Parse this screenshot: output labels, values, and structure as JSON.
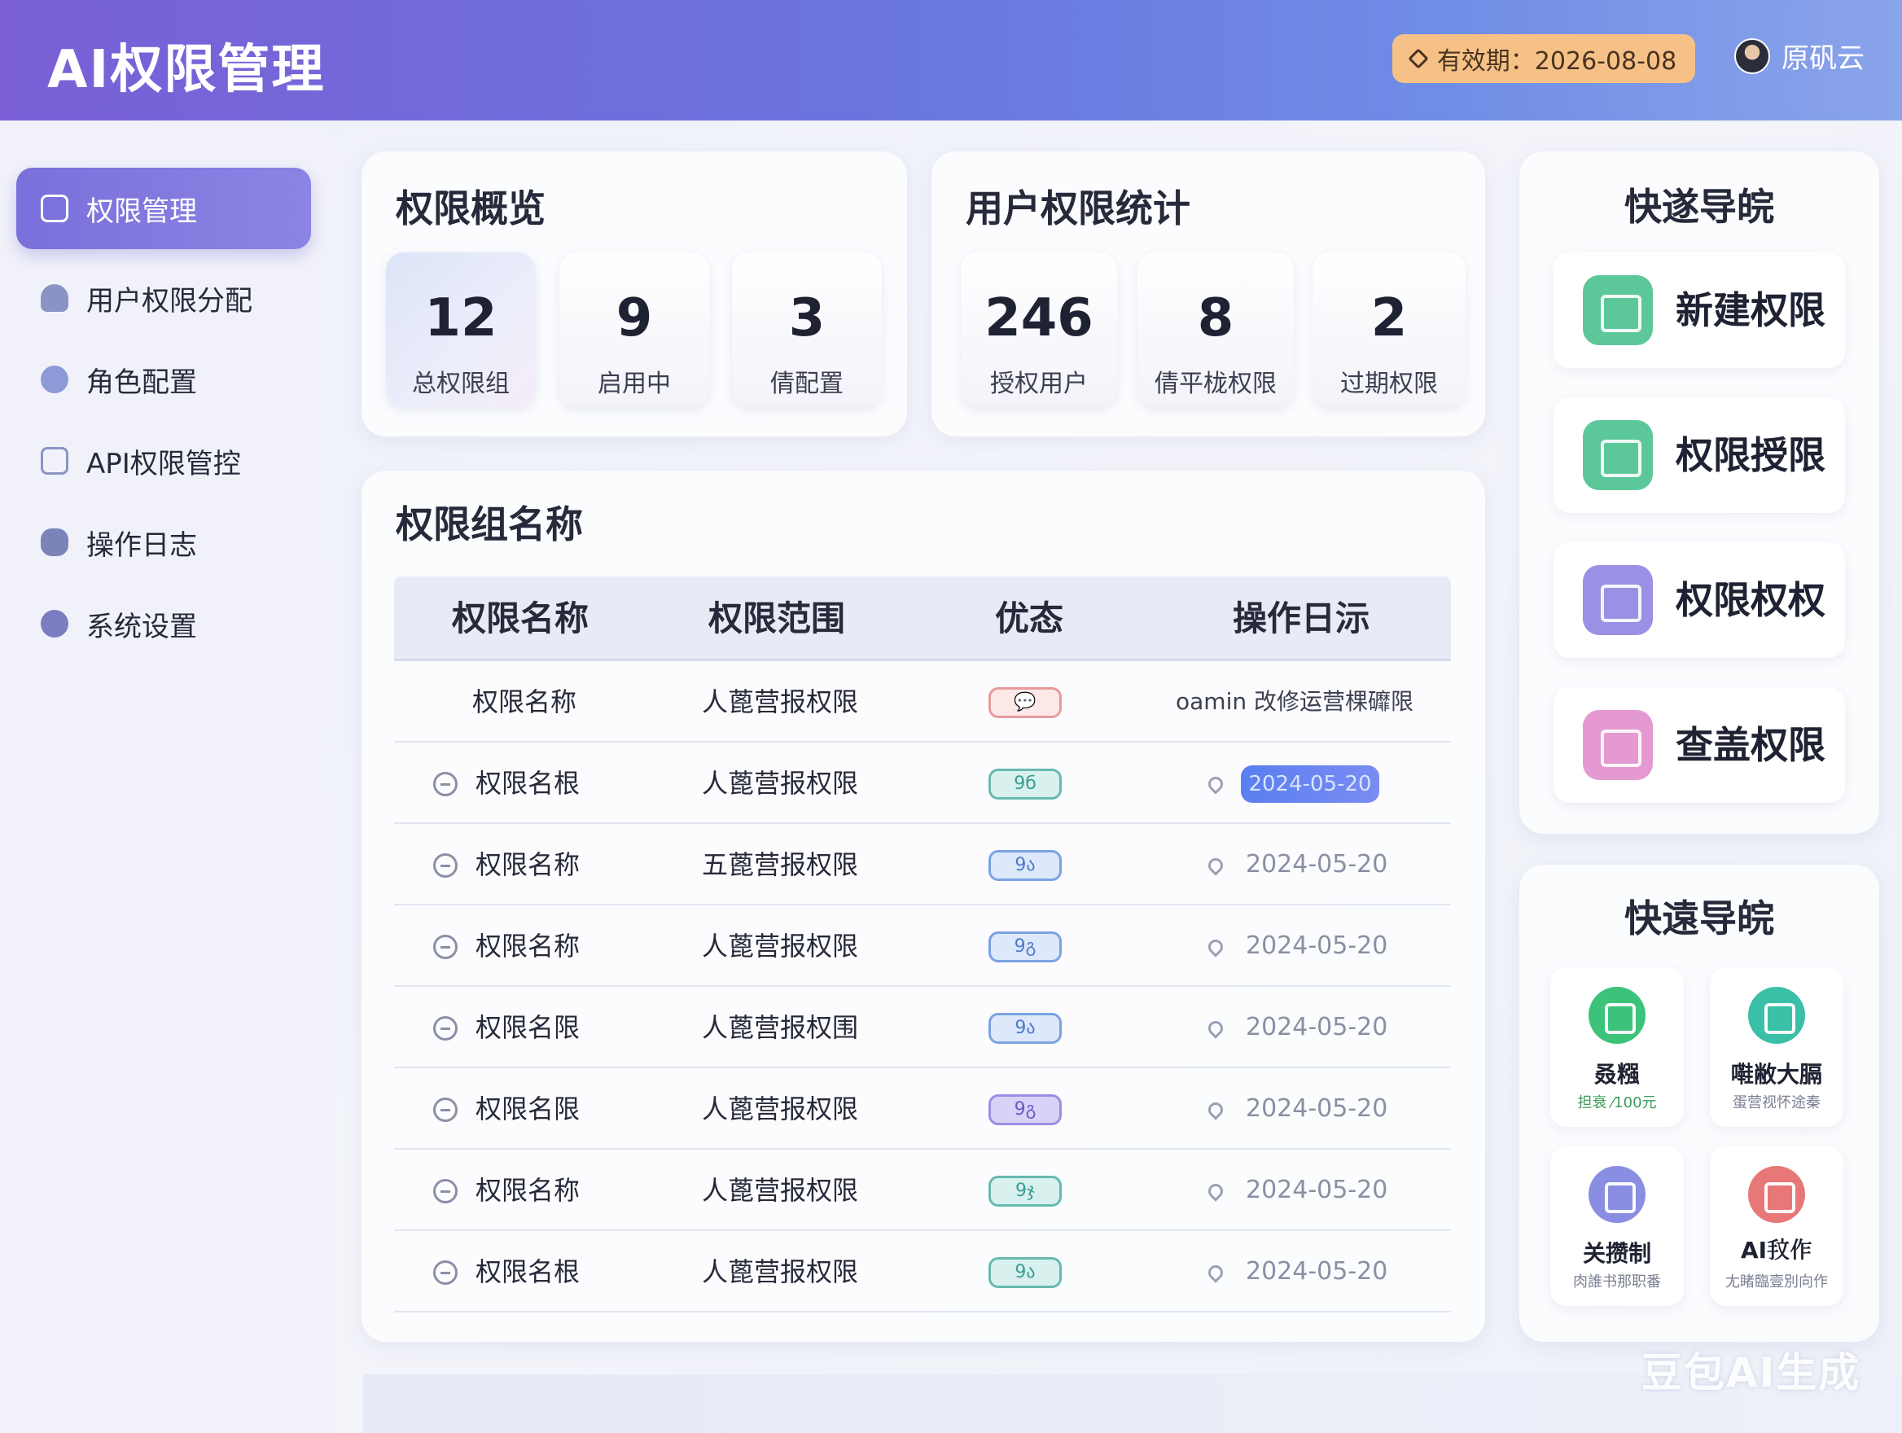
{
  "header": {
    "title": "AI权限管理",
    "validity": "有效期：2026-08-08",
    "user_name": "原矾云"
  },
  "sidebar": {
    "items": [
      {
        "label": "权限管理",
        "icon": "briefcase-icon",
        "active": true
      },
      {
        "label": "用户权限分配",
        "icon": "user-icon",
        "active": false
      },
      {
        "label": "角色配置",
        "icon": "role-icon",
        "active": false
      },
      {
        "label": "API权限管控",
        "icon": "api-icon",
        "active": false
      },
      {
        "label": "操作日志",
        "icon": "log-icon",
        "active": false
      },
      {
        "label": "系统设置",
        "icon": "settings-icon",
        "active": false
      }
    ]
  },
  "overview": {
    "title": "权限概览",
    "stats": [
      {
        "value": "12",
        "label": "总权限组"
      },
      {
        "value": "9",
        "label": "启用中"
      },
      {
        "value": "3",
        "label": "倩配置"
      }
    ]
  },
  "user_stats": {
    "title": "用户权限统计",
    "stats": [
      {
        "value": "246",
        "label": "授权用户"
      },
      {
        "value": "8",
        "label": "倩平栊权限"
      },
      {
        "value": "2",
        "label": "过期权限"
      }
    ]
  },
  "groups": {
    "title": "权限组名称",
    "columns": [
      "权限名称",
      "权限范围",
      "优态",
      "操作日沶"
    ],
    "rows": [
      {
        "name": "权限名称",
        "scope": "人蓖营报权限",
        "status": "💬",
        "color": "red",
        "log": "oamin 改修运营棵䃺限",
        "icon": false,
        "pill": false
      },
      {
        "name": "权限名根",
        "scope": "人蓖营报权限",
        "status": "9б",
        "color": "green",
        "log": "2024-05-20",
        "icon": true,
        "pill": true
      },
      {
        "name": "权限名称",
        "scope": "五蓖营报权限",
        "status": "9ა",
        "color": "blue",
        "log": "2024-05-20",
        "icon": true,
        "pill": false
      },
      {
        "name": "权限名称",
        "scope": "人蓖营报权限",
        "status": "9გ",
        "color": "blue",
        "log": "2024-05-20",
        "icon": true,
        "pill": false
      },
      {
        "name": "权限名限",
        "scope": "人蓖营报权围",
        "status": "9ა",
        "color": "blue",
        "log": "2024-05-20",
        "icon": true,
        "pill": false
      },
      {
        "name": "权限名限",
        "scope": "人蓖营报权限",
        "status": "9გ",
        "color": "purple",
        "log": "2024-05-20",
        "icon": true,
        "pill": false
      },
      {
        "name": "权限名称",
        "scope": "人蓖营报权限",
        "status": "9ჯ",
        "color": "green",
        "log": "2024-05-20",
        "icon": true,
        "pill": false
      },
      {
        "name": "权限名根",
        "scope": "人蓖营报权限",
        "status": "9ა",
        "color": "green",
        "log": "2024-05-20",
        "icon": true,
        "pill": false
      }
    ]
  },
  "quick_nav": {
    "title": "快遂导皖",
    "buttons": [
      {
        "label": "新建权限",
        "color": "#5cc89a"
      },
      {
        "label": "权限授限",
        "color": "#5cc89a"
      },
      {
        "label": "权限权权",
        "color": "#9a90e4"
      },
      {
        "label": "查盖权限",
        "color": "#e49ad0"
      }
    ]
  },
  "quick_nav2": {
    "title": "快遠导皖",
    "tiles": [
      {
        "title": "叒糨",
        "sub": "担衰 ⁄100元",
        "color": "#3dc27a"
      },
      {
        "title": "嚡敝大膈",
        "sub": "蛋营视怀途秦",
        "color": "#3bc0a8"
      },
      {
        "title": "关攒制",
        "sub": "肉誰书那职番",
        "color": "#8a8ee2"
      },
      {
        "title": "AI𢪖作",
        "sub": "尢睹臨壹別向作",
        "color": "#e87878"
      }
    ]
  },
  "watermark": "豆包AI生成"
}
